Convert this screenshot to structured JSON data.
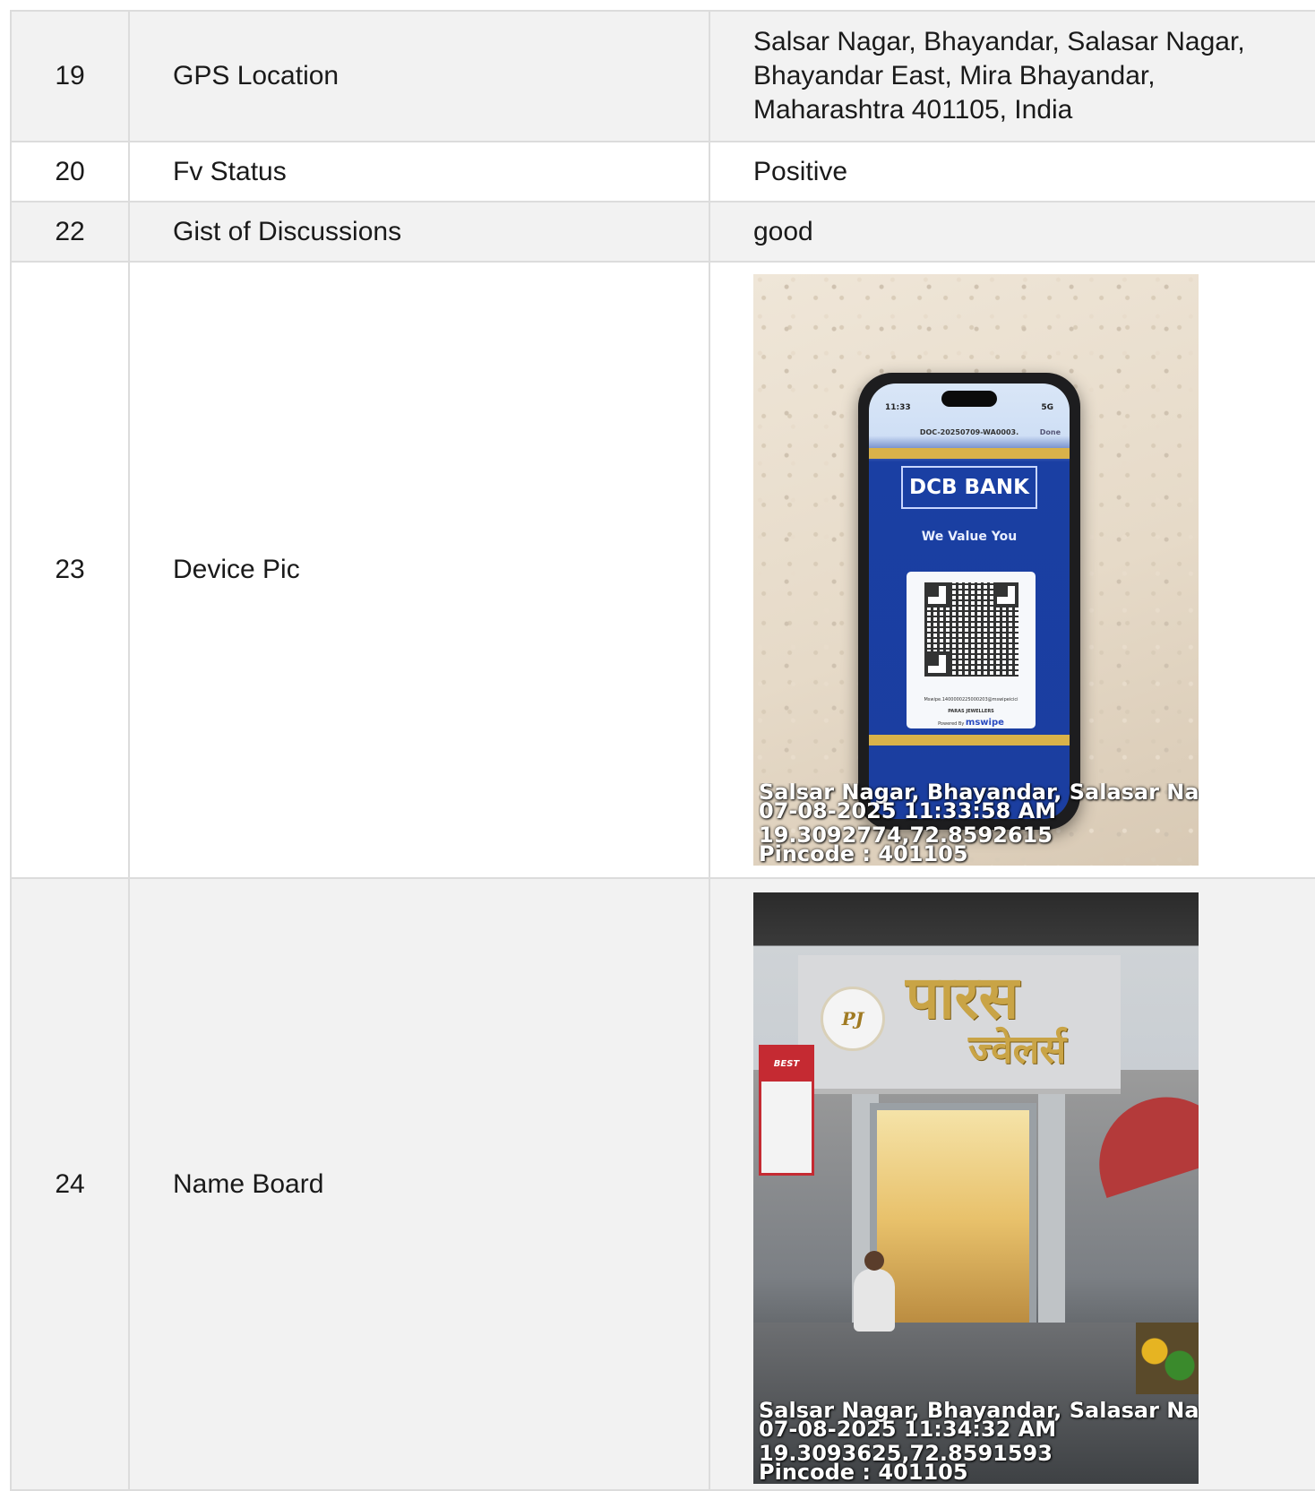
{
  "rows": [
    {
      "no": "19",
      "label": "GPS Location",
      "value": "Salsar Nagar, Bhayandar, Salasar Nagar, Bhayandar East, Mira Bhayandar, Maharashtra 401105, India"
    },
    {
      "no": "20",
      "label": "Fv Status",
      "value": "Positive"
    },
    {
      "no": "22",
      "label": "Gist of Discussions",
      "value": "good"
    },
    {
      "no": "23",
      "label": "Device Pic"
    },
    {
      "no": "24",
      "label": "Name Board"
    }
  ],
  "device_photo": {
    "phone_time": "11:33",
    "phone_signal": "5G",
    "doc_name": "DOC-20250709-WA0003.",
    "doc_done": "Done",
    "bank_name": "DCB BANK",
    "bank_tagline": "We Value You",
    "upi_id": "Mswipe.1400000225000203@mswipeicici",
    "merchant": "PARAS JEWELLERS",
    "powered_by": "Powered By",
    "brand": "mswipe",
    "stamp_address": "Salsar Nagar, Bhayandar, Salasar Nagar, Bha",
    "stamp_datetime": "07-08-2025 11:33:58 AM",
    "stamp_coords": "19.3092774,72.8592615",
    "stamp_pincode": "Pincode : 401105"
  },
  "board_photo": {
    "logo_text": "PJ",
    "sign_line1": "पारस",
    "sign_line2": "ज्वेलर्स",
    "busstop_text": "BEST",
    "stamp_address": "Salsar Nagar, Bhayandar, Salasar Nagar, Bha",
    "stamp_datetime": "07-08-2025 11:34:32 AM",
    "stamp_coords": "19.3093625,72.8591593",
    "stamp_pincode": "Pincode : 401105"
  },
  "colors": {
    "shaded_row": "#f2f2f2",
    "border": "#dcdcdc",
    "bank_blue": "#1b3ea0",
    "bank_gold": "#d9b24a"
  }
}
